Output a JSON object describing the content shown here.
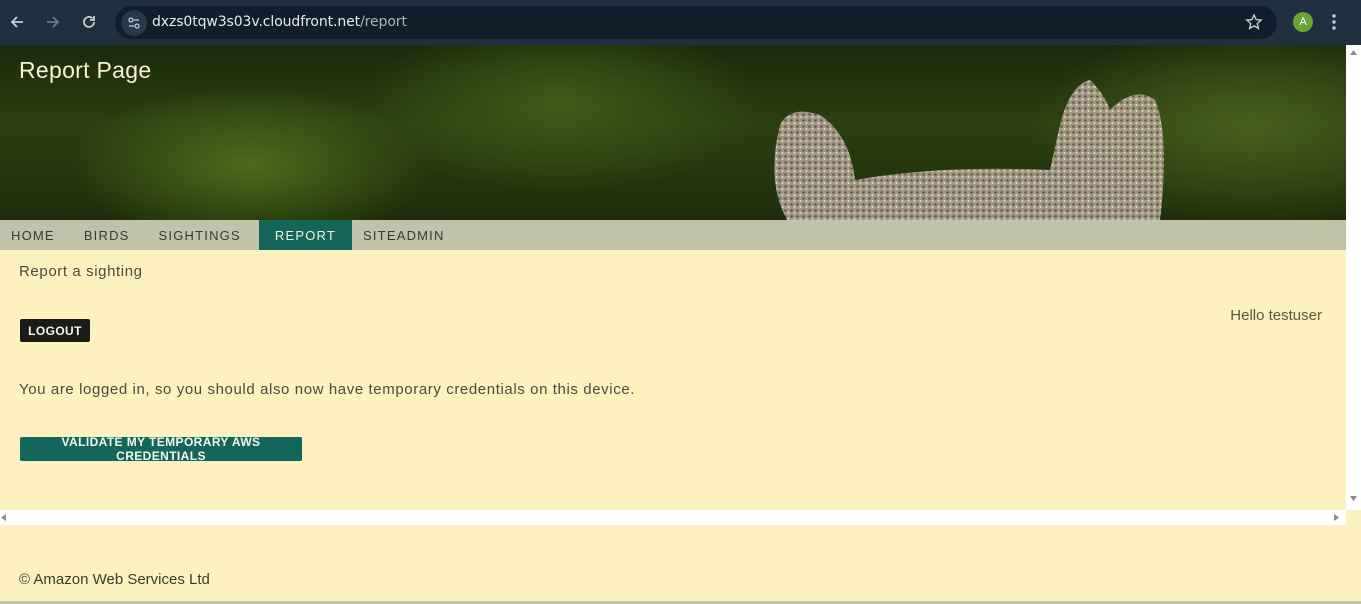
{
  "browser": {
    "url_host": "dxzs0tqw3s03v.cloudfront.net",
    "url_path": "/report",
    "profile_initial": "A",
    "icons": [
      "back-icon",
      "forward-icon",
      "reload-icon",
      "site-info-icon",
      "star-icon",
      "kebab-menu-icon"
    ]
  },
  "page": {
    "title": "Report Page"
  },
  "nav": {
    "items": [
      {
        "label": "HOME"
      },
      {
        "label": "BIRDS"
      },
      {
        "label": "SIGHTINGS"
      },
      {
        "label": "REPORT",
        "active": true
      },
      {
        "label": "SITEADMIN"
      }
    ]
  },
  "content": {
    "subtitle": "Report a sighting",
    "greeting": "Hello testuser",
    "logout_label": "LOGOUT",
    "message": "You are logged in, so you should also now have temporary credentials on this device.",
    "validate_label": "VALIDATE MY TEMPORARY AWS CREDENTIALS"
  },
  "footer": {
    "copyright": "© Amazon Web Services Ltd"
  },
  "colors": {
    "accent": "#15665a",
    "background": "#fef1c0",
    "navbar": "#c0c3aa"
  }
}
